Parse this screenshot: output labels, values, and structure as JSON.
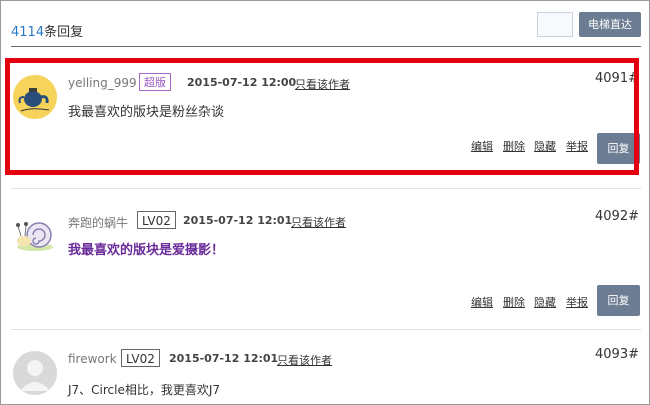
{
  "header": {
    "reply_count_num": "4114",
    "reply_count_suffix": "条回复",
    "jump_button": "电梯直达"
  },
  "posts": [
    {
      "user": "yelling_999",
      "badge": "超版",
      "time": "2015-07-12 12:00",
      "author_only": "只看该作者",
      "floor": "4091#",
      "content": "我最喜欢的版块是粉丝杂谈",
      "actions": [
        "编辑",
        "删除",
        "隐藏",
        "举报"
      ],
      "reply": "回复"
    },
    {
      "user": "奔跑的蜗牛",
      "badge": "LV02",
      "time": "2015-07-12 12:01",
      "author_only": "只看该作者",
      "floor": "4092#",
      "content": "我最喜欢的版块是爱摄影！",
      "actions": [
        "编辑",
        "删除",
        "隐藏",
        "举报"
      ],
      "reply": "回复"
    },
    {
      "user": "firework",
      "badge": "LV02",
      "time": "2015-07-12 12:01",
      "author_only": "只看该作者",
      "floor": "4093#",
      "content": "J7、Circle相比，我更喜欢J7"
    }
  ],
  "colors": {
    "highlight_border": "#e4000f",
    "button_bg": "#6b7c93",
    "count_accent": "#2b78c5",
    "highlight_text": "#6a2b9a"
  }
}
